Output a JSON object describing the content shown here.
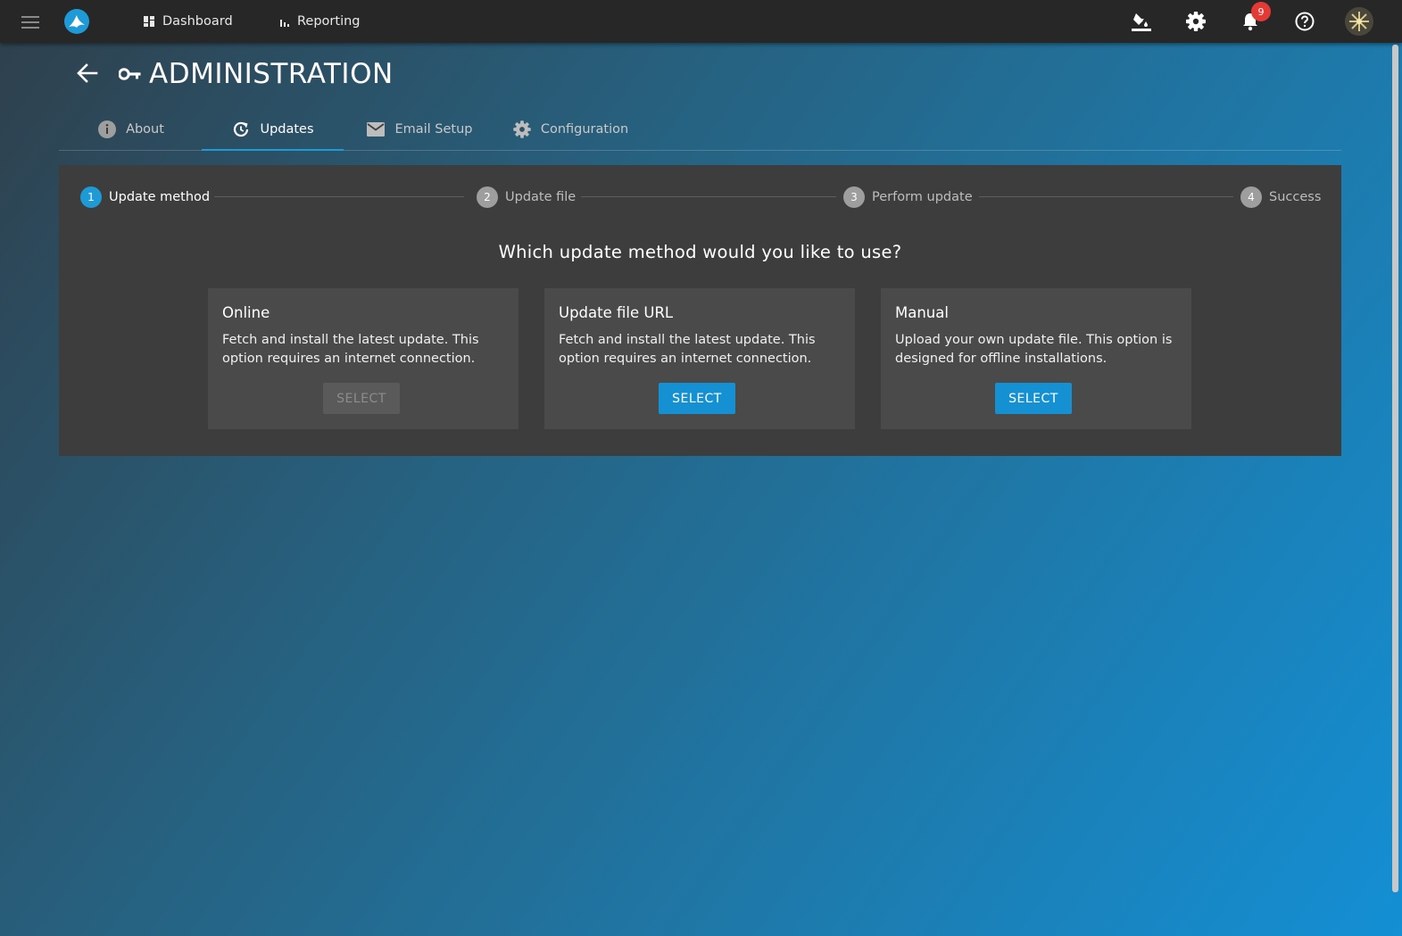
{
  "topbar": {
    "nav": [
      {
        "label": "Dashboard",
        "icon": "dashboard-icon"
      },
      {
        "label": "Reporting",
        "icon": "bar-chart-icon"
      }
    ],
    "notification_count": "9"
  },
  "header": {
    "title": "ADMINISTRATION"
  },
  "tabs": [
    {
      "label": "About",
      "icon": "info-icon",
      "active": false
    },
    {
      "label": "Updates",
      "icon": "update-icon",
      "active": true
    },
    {
      "label": "Email Setup",
      "icon": "mail-icon",
      "active": false
    },
    {
      "label": "Configuration",
      "icon": "gear-icon",
      "active": false
    }
  ],
  "stepper": [
    {
      "num": "1",
      "label": "Update method",
      "active": true
    },
    {
      "num": "2",
      "label": "Update file",
      "active": false
    },
    {
      "num": "3",
      "label": "Perform update",
      "active": false
    },
    {
      "num": "4",
      "label": "Success",
      "active": false
    }
  ],
  "question": "Which update method would you like to use?",
  "cards": [
    {
      "title": "Online",
      "description": "Fetch and install the latest update. This option requires an internet connection.",
      "button": "SELECT",
      "disabled": true
    },
    {
      "title": "Update file URL",
      "description": "Fetch and install the latest update. This option requires an internet connection.",
      "button": "SELECT",
      "disabled": false
    },
    {
      "title": "Manual",
      "description": "Upload your own update file. This option is designed for offline installations.",
      "button": "SELECT",
      "disabled": false
    }
  ],
  "colors": {
    "accent": "#1591d3",
    "topbar": "#272727",
    "panel": "#3d3d3d",
    "card": "#4a4a4a",
    "badge": "#e53935"
  }
}
